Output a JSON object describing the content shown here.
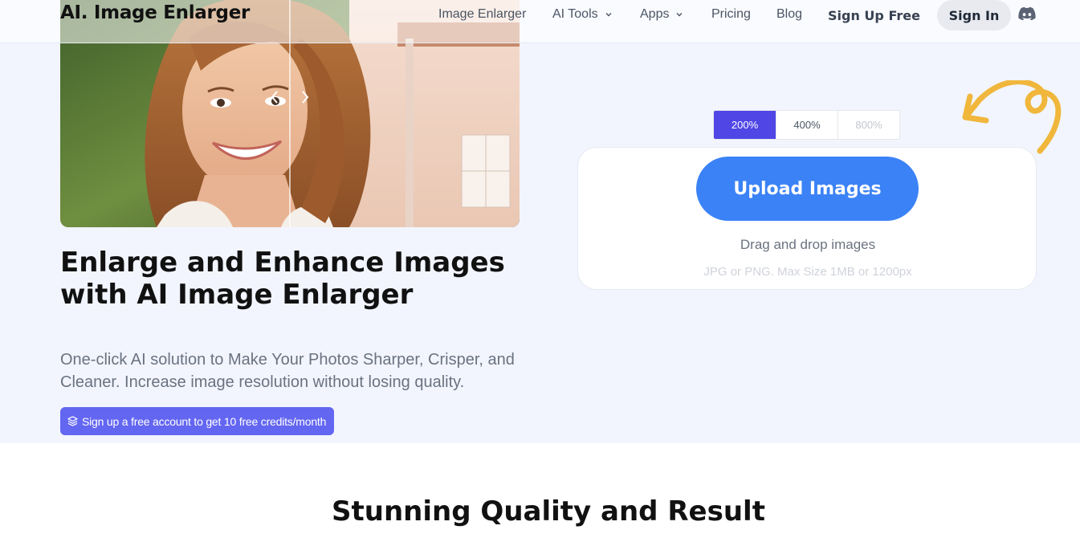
{
  "nav": {
    "logo": "AI. Image Enlarger",
    "links": {
      "image_enlarger": "Image Enlarger",
      "ai_tools": "AI Tools",
      "apps": "Apps",
      "pricing": "Pricing",
      "blog": "Blog"
    },
    "signup": "Sign Up Free",
    "signin": "Sign In",
    "discord_icon": "discord-icon"
  },
  "hero": {
    "headline": "Enlarge and Enhance Images with AI Image Enlarger",
    "subtext": "One-click AI solution to Make Your Photos Sharper, Crisper, and Cleaner. Increase image resolution without losing quality.",
    "promo": "Sign up a free account to get 10 free credits/month",
    "promo_icon": "layers-icon"
  },
  "uploader": {
    "scales": [
      "200%",
      "400%",
      "800%"
    ],
    "selected_scale": "200%",
    "button": "Upload Images",
    "drag_text": "Drag and drop images",
    "format_text": "JPG or PNG. Max Size 1MB or 1200px"
  },
  "section": {
    "title": "Stunning Quality and Result"
  },
  "colors": {
    "primary_blue": "#3b82f6",
    "indigo": "#4f46e5",
    "promo_purple": "#6366f1",
    "hero_bg": "#f2f5fe",
    "doodle": "#f0b73c"
  }
}
